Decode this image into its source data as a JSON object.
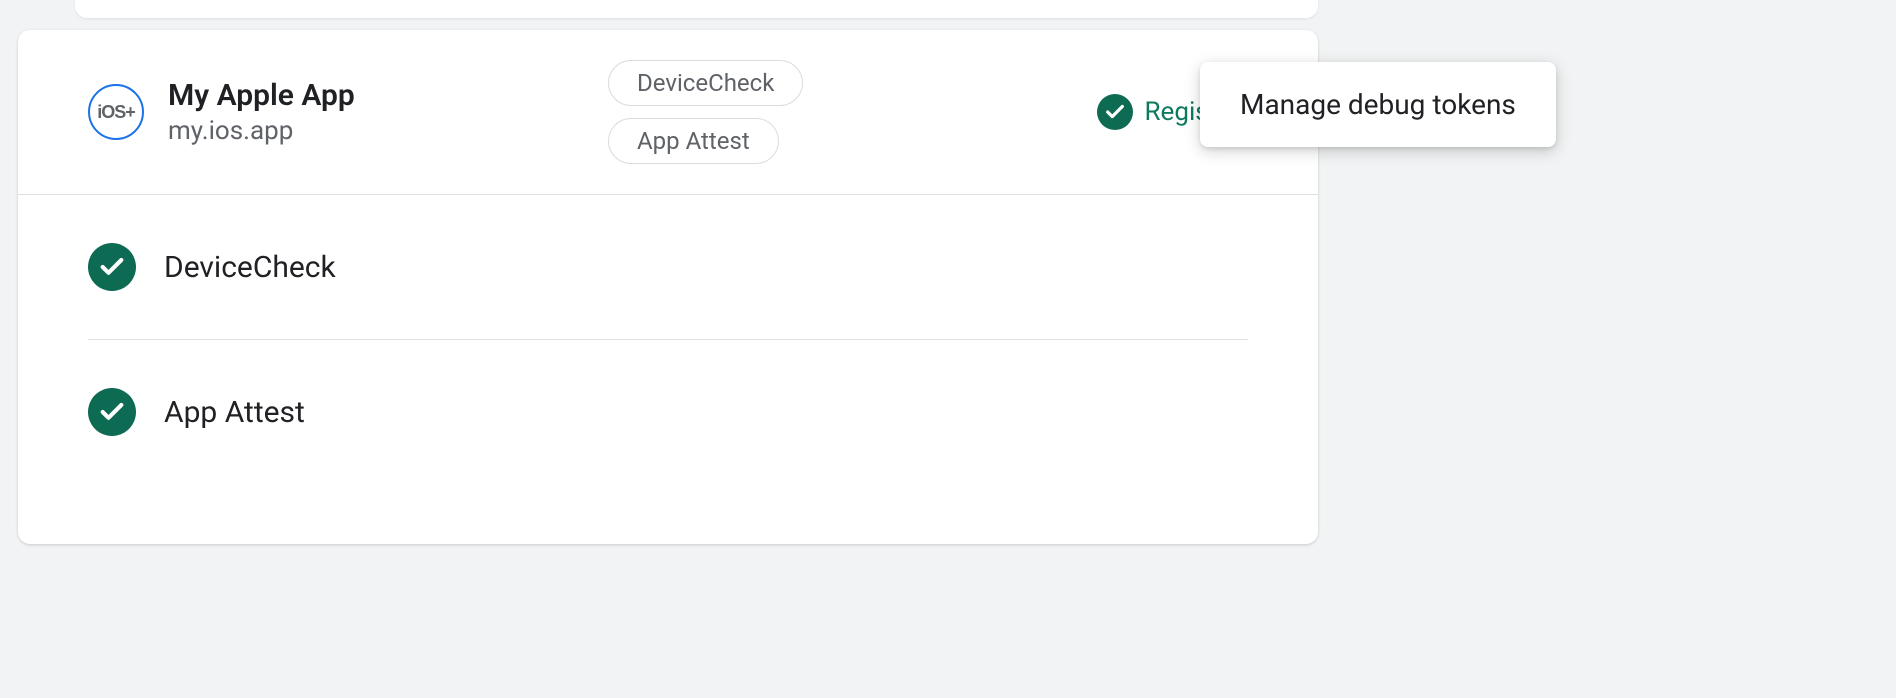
{
  "app": {
    "icon_label": "iOS+",
    "title": "My Apple App",
    "bundle_id": "my.ios.app"
  },
  "chips": {
    "device_check": "DeviceCheck",
    "app_attest": "App Attest"
  },
  "status": {
    "label": "Registered"
  },
  "providers": [
    {
      "name": "DeviceCheck"
    },
    {
      "name": "App Attest"
    }
  ],
  "menu": {
    "manage_debug_tokens": "Manage debug tokens"
  }
}
